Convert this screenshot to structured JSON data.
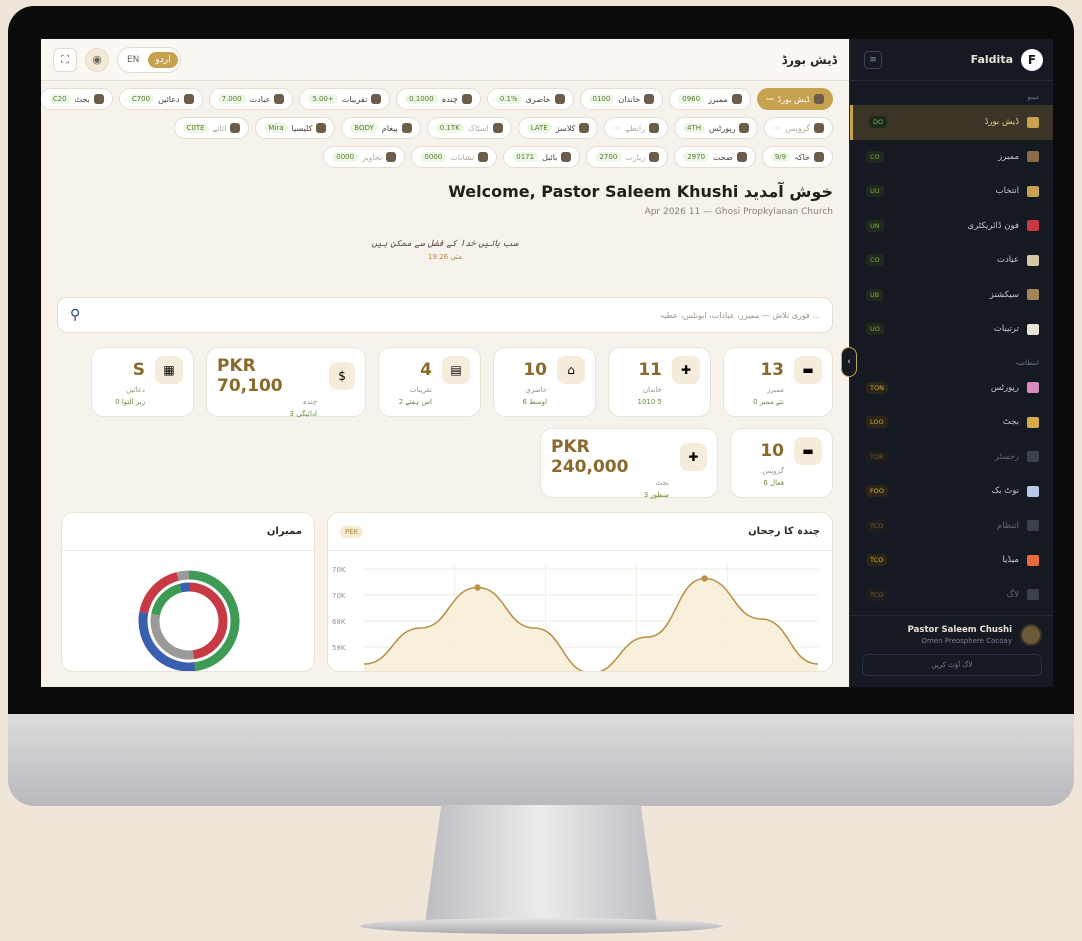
{
  "topbar": {
    "lang_en": "EN",
    "lang_ur": "اردو",
    "page_name": "ڈیش بورڈ"
  },
  "chips": [
    [
      {
        "label": "ڈیش بورڈ",
        "count": "",
        "active": true
      },
      {
        "label": "ممبرز",
        "count": "0960"
      },
      {
        "label": "خاندان",
        "count": "0100"
      },
      {
        "label": "حاضری",
        "count": "0.1%"
      },
      {
        "label": "چندہ",
        "count": "0.1000"
      },
      {
        "label": "تقریبات",
        "count": "5.00+"
      },
      {
        "label": "عبادت",
        "count": "7.000"
      },
      {
        "label": "دعائیں",
        "count": "C700"
      },
      {
        "label": "بجٹ",
        "count": "C20"
      }
    ],
    [
      {
        "label": "گروپس",
        "count": "",
        "faded": true
      },
      {
        "label": "رپورٹس",
        "count": "4TH"
      },
      {
        "label": "رابطے",
        "count": "",
        "faded": true
      },
      {
        "label": "کلاسز",
        "count": "LATE"
      },
      {
        "label": "اسٹاک",
        "count": "0.1TK",
        "faded": true
      },
      {
        "label": "پیغام",
        "count": "BODY"
      },
      {
        "label": "کلیسیا",
        "count": "Mira"
      },
      {
        "label": "اثاثے",
        "count": "C0TE",
        "faded": true
      }
    ],
    [
      {
        "label": "خاکہ",
        "count": "9/9"
      },
      {
        "label": "صحت",
        "count": "2970"
      },
      {
        "label": "زیارت",
        "count": "2700",
        "faded": true
      },
      {
        "label": "بائبل",
        "count": "0171"
      },
      {
        "label": "نشانات",
        "count": "0000",
        "faded": true
      },
      {
        "label": "تجاویز",
        "count": "0000",
        "faded": true
      }
    ]
  ],
  "welcome": {
    "title": "Welcome, Pastor Saleem Khushi",
    "title_prefix": "خوش آمدید",
    "subtitle": "Apr 2026 11 — Ghosi Propkylanan Church"
  },
  "verse": {
    "text": "سب باتیں خدا کے فضل سے ممکن ہیں",
    "ref": "متی 19:26"
  },
  "search": {
    "placeholder": "فوری تلاش — ممبرز، عبادات، ایونٹس، عطیہ ..."
  },
  "stats": [
    {
      "value": "13",
      "label": "ممبرز",
      "note": "0 نئے ممبر"
    },
    {
      "value": "11",
      "label": "خاندان",
      "note": "1010 5"
    },
    {
      "value": "10",
      "label": "حاضری",
      "note": "6 اوسط"
    },
    {
      "value": "4",
      "label": "تقریبات",
      "note": "2 اس ہفتے"
    },
    {
      "value": "PKR 70,100",
      "label": "چندہ",
      "note": "3 ادائیگی"
    },
    {
      "value": "S",
      "label": "دعائیں",
      "note": "0 زیر التوا"
    }
  ],
  "stats2": [
    {
      "value": "10",
      "label": "گروپس",
      "note": "6 فعال"
    },
    {
      "value": "PKR 240,000",
      "label": "بجٹ",
      "note": "3 منظور"
    }
  ],
  "chart_panel": {
    "title": "چندہ کا رجحان",
    "pill": "PEK"
  },
  "donut_panel": {
    "title": "ممبران"
  },
  "chart_data": {
    "type": "area",
    "title": "چندہ کا رجحان",
    "y_ticks": [
      "70K",
      "70K",
      "68K",
      "58K"
    ],
    "x": [
      0,
      1,
      2,
      3,
      4,
      5,
      6,
      7,
      8
    ],
    "values": [
      52,
      60,
      69,
      60,
      50,
      58,
      71,
      62,
      52
    ],
    "ylim": [
      50,
      74
    ],
    "series_color": "#b8924a",
    "grid": true
  },
  "donut_data": {
    "type": "pie",
    "values": [
      48,
      30,
      18,
      4
    ],
    "colors": [
      "#3f9a55",
      "#3a5fb0",
      "#c73a44",
      "#9a9a9a"
    ]
  },
  "sidebar": {
    "brand": "Faldita",
    "logo_letter": "F",
    "section_main": "مینو",
    "section_admin": "انتظامیہ",
    "items_main": [
      {
        "label": "ڈیش بورڈ",
        "badge": "DO",
        "active": true,
        "color": "#c7a24f"
      },
      {
        "label": "ممبرز",
        "badge": "CO",
        "color": "#8b6b4a"
      },
      {
        "label": "انتخاب",
        "badge": "UU",
        "color": "#c7a24f"
      },
      {
        "label": "فون ڈائریکٹری",
        "badge": "UN",
        "color": "#c73a44"
      },
      {
        "label": "عبادت",
        "badge": "CO",
        "color": "#d7c7a7"
      },
      {
        "label": "سیکشنز",
        "badge": "UB",
        "color": "#a2865a"
      },
      {
        "label": "ترتیبات",
        "badge": "UO",
        "color": "#e8e3d8"
      }
    ],
    "items_admin": [
      {
        "label": "رپورٹس",
        "badge": "TON",
        "b2": true,
        "color": "#d98ac0"
      },
      {
        "label": "بجٹ",
        "badge": "LOO",
        "b2": true,
        "color": "#d7a94a"
      },
      {
        "label": "رجسٹر",
        "badge": "TOR",
        "b2": true,
        "dim": true,
        "color": "#6b7286"
      },
      {
        "label": "نوٹ بک",
        "badge": "FOO",
        "b2": true,
        "color": "#b9c7e8"
      },
      {
        "label": "انتظام",
        "badge": "TCO",
        "b2": true,
        "dim": true,
        "color": "#6b7286"
      },
      {
        "label": "میڈیا",
        "badge": "TCO",
        "b2": true,
        "color": "#e86a3a"
      },
      {
        "label": "لاگ",
        "badge": "TCO",
        "b2": true,
        "dim": true,
        "color": "#6b7286"
      }
    ],
    "user_name": "Pastor Saleem Chushi",
    "user_role": "Omen Preosphere Cocoay",
    "logout": "لاگ آؤٹ کریں"
  }
}
